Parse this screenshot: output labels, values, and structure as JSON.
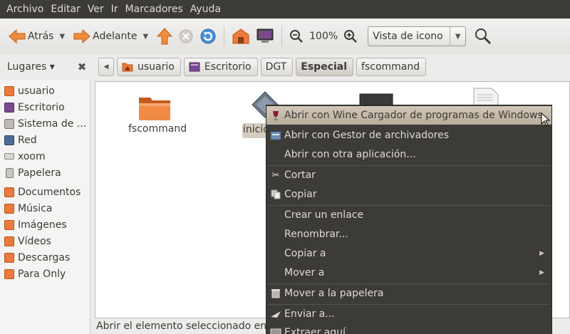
{
  "menubar": [
    "Archivo",
    "Editar",
    "Ver",
    "Ir",
    "Marcadores",
    "Ayuda"
  ],
  "toolbar": {
    "back_label": "Atrás",
    "forward_label": "Adelante",
    "zoom": "100%",
    "view_mode": "Vista de icono"
  },
  "places": {
    "label": "Lugares ▾"
  },
  "breadcrumbs": [
    "usuario",
    "Escritorio",
    "DGT",
    "Especial",
    "fscommand"
  ],
  "sidebar": [
    {
      "label": "usuario",
      "icon": "home-folder-icon"
    },
    {
      "label": "Escritorio",
      "icon": "desktop-icon"
    },
    {
      "label": "Sistema de ...",
      "icon": "filesystem-icon"
    },
    {
      "label": "Red",
      "icon": "network-icon"
    },
    {
      "label": "xoom",
      "icon": "drive-icon"
    },
    {
      "label": "Papelera",
      "icon": "trash-icon"
    },
    {
      "label": "Documentos",
      "icon": "documents-folder-icon"
    },
    {
      "label": "Música",
      "icon": "music-folder-icon"
    },
    {
      "label": "Imágenes",
      "icon": "pictures-folder-icon"
    },
    {
      "label": "Vídeos",
      "icon": "videos-folder-icon"
    },
    {
      "label": "Descargas",
      "icon": "downloads-folder-icon"
    },
    {
      "label": "Para Only",
      "icon": "folder-icon"
    }
  ],
  "files": [
    {
      "name": "fscommand",
      "icon": "folder-icon"
    },
    {
      "name": "inicio",
      "icon": "wine-executable-icon"
    }
  ],
  "context_menu": [
    {
      "label": "Abrir con Wine Cargador de programas de Windows",
      "icon": "wine-icon"
    },
    {
      "label": "Abrir con Gestor de archivadores",
      "icon": "archive-manager-icon"
    },
    {
      "label": "Abrir con otra aplicación..."
    },
    {
      "label": "Cortar",
      "icon": "scissors-icon"
    },
    {
      "label": "Copiar",
      "icon": "copy-icon"
    },
    {
      "label": "Crear un enlace"
    },
    {
      "label": "Renombrar..."
    },
    {
      "label": "Copiar a"
    },
    {
      "label": "Mover a"
    },
    {
      "label": "Mover a la papelera",
      "icon": "trash-icon"
    },
    {
      "label": "Enviar a...",
      "icon": "send-icon"
    },
    {
      "label": "Extraer aquí",
      "icon": "extract-icon"
    }
  ],
  "status": "Abrir el elemento seleccionado en es",
  "colors": {
    "menubar_bg": "#3c3b37",
    "menu_fg": "#dfdbd2",
    "highlight": "#c9bfae",
    "folder_orange": "#ec7a3c"
  }
}
